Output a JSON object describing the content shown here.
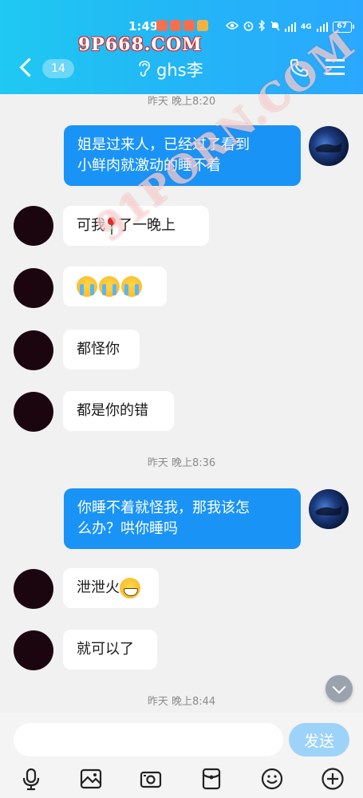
{
  "status_bar": {
    "time": "1:49",
    "battery": "67",
    "network": "4G"
  },
  "watermark_top": "9P668.COM",
  "watermark_mid": "91PORN.COM",
  "header": {
    "back_badge": "14",
    "title": "ghs李"
  },
  "messages": [
    {
      "type": "timestamp",
      "text": "昨天 晚上8:20"
    },
    {
      "type": "out",
      "text": "姐是过来人，已经过了看到\n小鲜肉就激动的睡不着"
    },
    {
      "type": "in",
      "text_before": "可我",
      "text_after": "了一晚上",
      "emoji": "rose"
    },
    {
      "type": "in",
      "emoji": [
        "loudly-crying",
        "loudly-crying",
        "loudly-crying"
      ]
    },
    {
      "type": "in",
      "text": "都怪你"
    },
    {
      "type": "in",
      "text": "都是你的错"
    },
    {
      "type": "timestamp",
      "text": "昨天 晚上8:36"
    },
    {
      "type": "out",
      "text": "你睡不着就怪我，那我该怎\n么办？哄你睡吗"
    },
    {
      "type": "in",
      "text": "泄泄火",
      "emoji": "grimacing"
    },
    {
      "type": "in",
      "text": "就可以了"
    },
    {
      "type": "timestamp",
      "text": "昨天 晚上8:44"
    }
  ],
  "input": {
    "placeholder": "",
    "send_label": "发送"
  },
  "colors": {
    "header_gradient_start": "#1fc9f2",
    "header_gradient_end": "#2aa8ff",
    "outgoing_bubble": "#1a93f7",
    "incoming_bubble": "#ffffff",
    "chat_background": "#f1f1f1",
    "send_button": "#9ed3f9"
  },
  "toolbar_icons": [
    "microphone-icon",
    "image-icon",
    "camera-icon",
    "red-packet-icon",
    "emoji-icon",
    "plus-icon"
  ]
}
